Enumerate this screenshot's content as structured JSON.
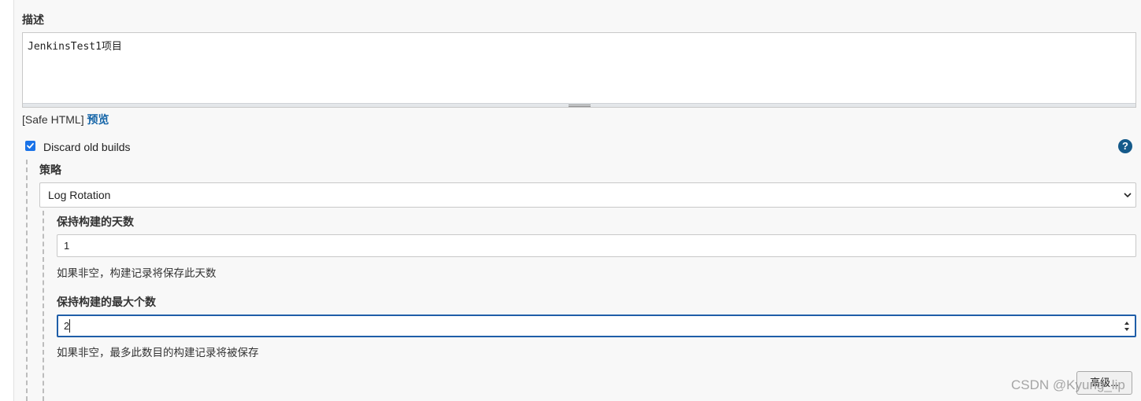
{
  "description": {
    "label": "描述",
    "value": "JenkinsTest1项目",
    "safe_html": "[Safe HTML]",
    "preview_link": "预览"
  },
  "discard_old_builds": {
    "label": "Discard old builds",
    "checked": true,
    "help_icon": "?"
  },
  "strategy": {
    "label": "策略",
    "selected": "Log Rotation"
  },
  "days_to_keep": {
    "label": "保持构建的天数",
    "value": "1",
    "hint": "如果非空，构建记录将保存此天数"
  },
  "max_builds": {
    "label": "保持构建的最大个数",
    "value": "2",
    "hint": "如果非空，最多此数目的构建记录将被保存"
  },
  "advanced_button": "高级...",
  "watermark": "CSDN @Kyung_lip",
  "colors": {
    "accent": "#1a73e8",
    "link": "#1565a8",
    "focus": "#1f5ea8",
    "help": "#155a8a"
  }
}
